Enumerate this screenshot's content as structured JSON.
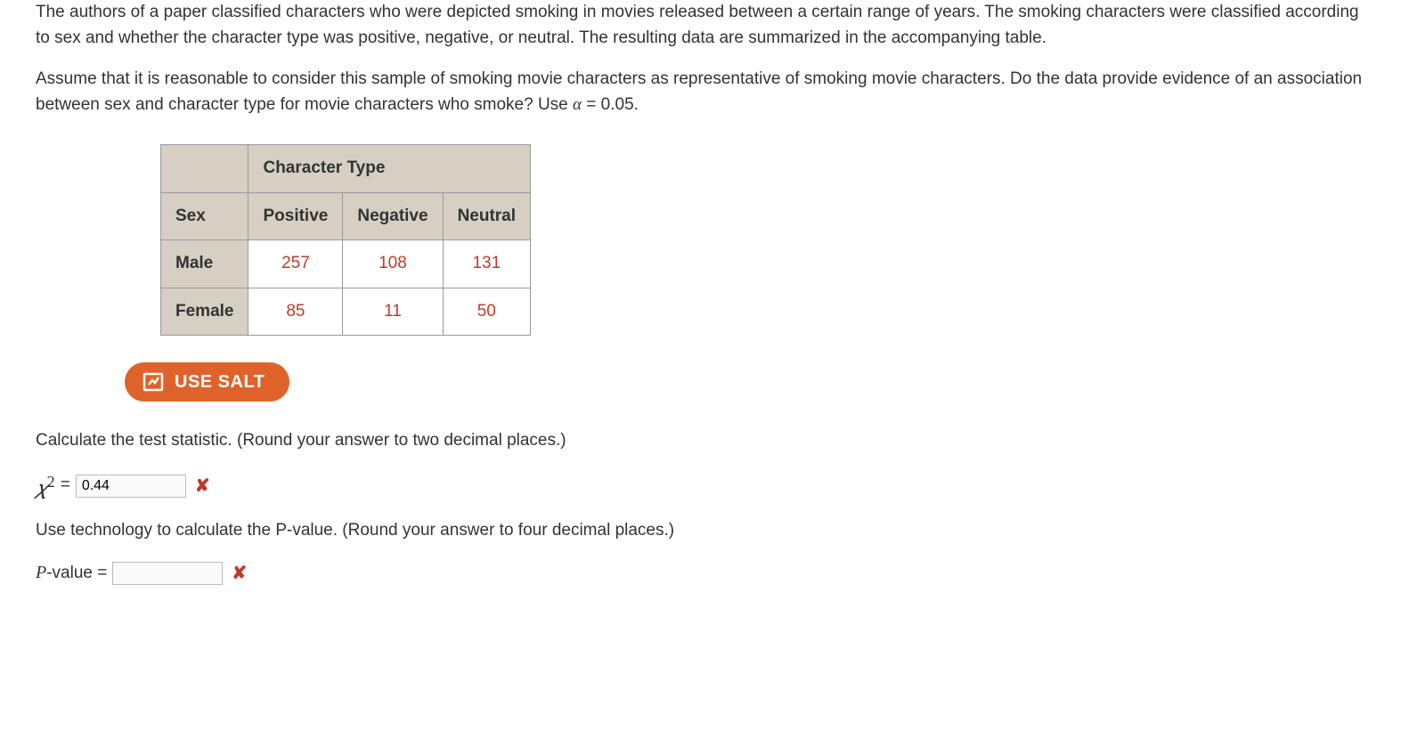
{
  "problem": {
    "para1": "The authors of a paper classified characters who were depicted smoking in movies released between a certain range of years. The smoking characters were classified according to sex and whether the character type was positive, negative, or neutral. The resulting data are summarized in the accompanying table.",
    "para2_pre": "Assume that it is reasonable to consider this sample of smoking movie characters as representative of smoking movie characters. Do the data provide evidence of an association between sex and character type for movie characters who smoke? Use ",
    "alpha_var": "α",
    "alpha_eq": " = 0.05."
  },
  "table": {
    "span_header": "Character Type",
    "row_header": "Sex",
    "cols": [
      "Positive",
      "Negative",
      "Neutral"
    ],
    "rows": [
      {
        "label": "Male",
        "values": [
          "257",
          "108",
          "131"
        ]
      },
      {
        "label": "Female",
        "values": [
          "85",
          "11",
          "50"
        ]
      }
    ]
  },
  "salt_button": "USE SALT",
  "q1": {
    "prompt": "Calculate the test statistic. (Round your answer to two decimal places.)",
    "symbol": "𝜒",
    "exp": "2",
    "eq": " = ",
    "value": "0.44"
  },
  "q2": {
    "prompt": "Use technology to calculate the P-value. (Round your answer to four decimal places.)",
    "label_pre": "P",
    "label_post": "-value = ",
    "value": ""
  }
}
